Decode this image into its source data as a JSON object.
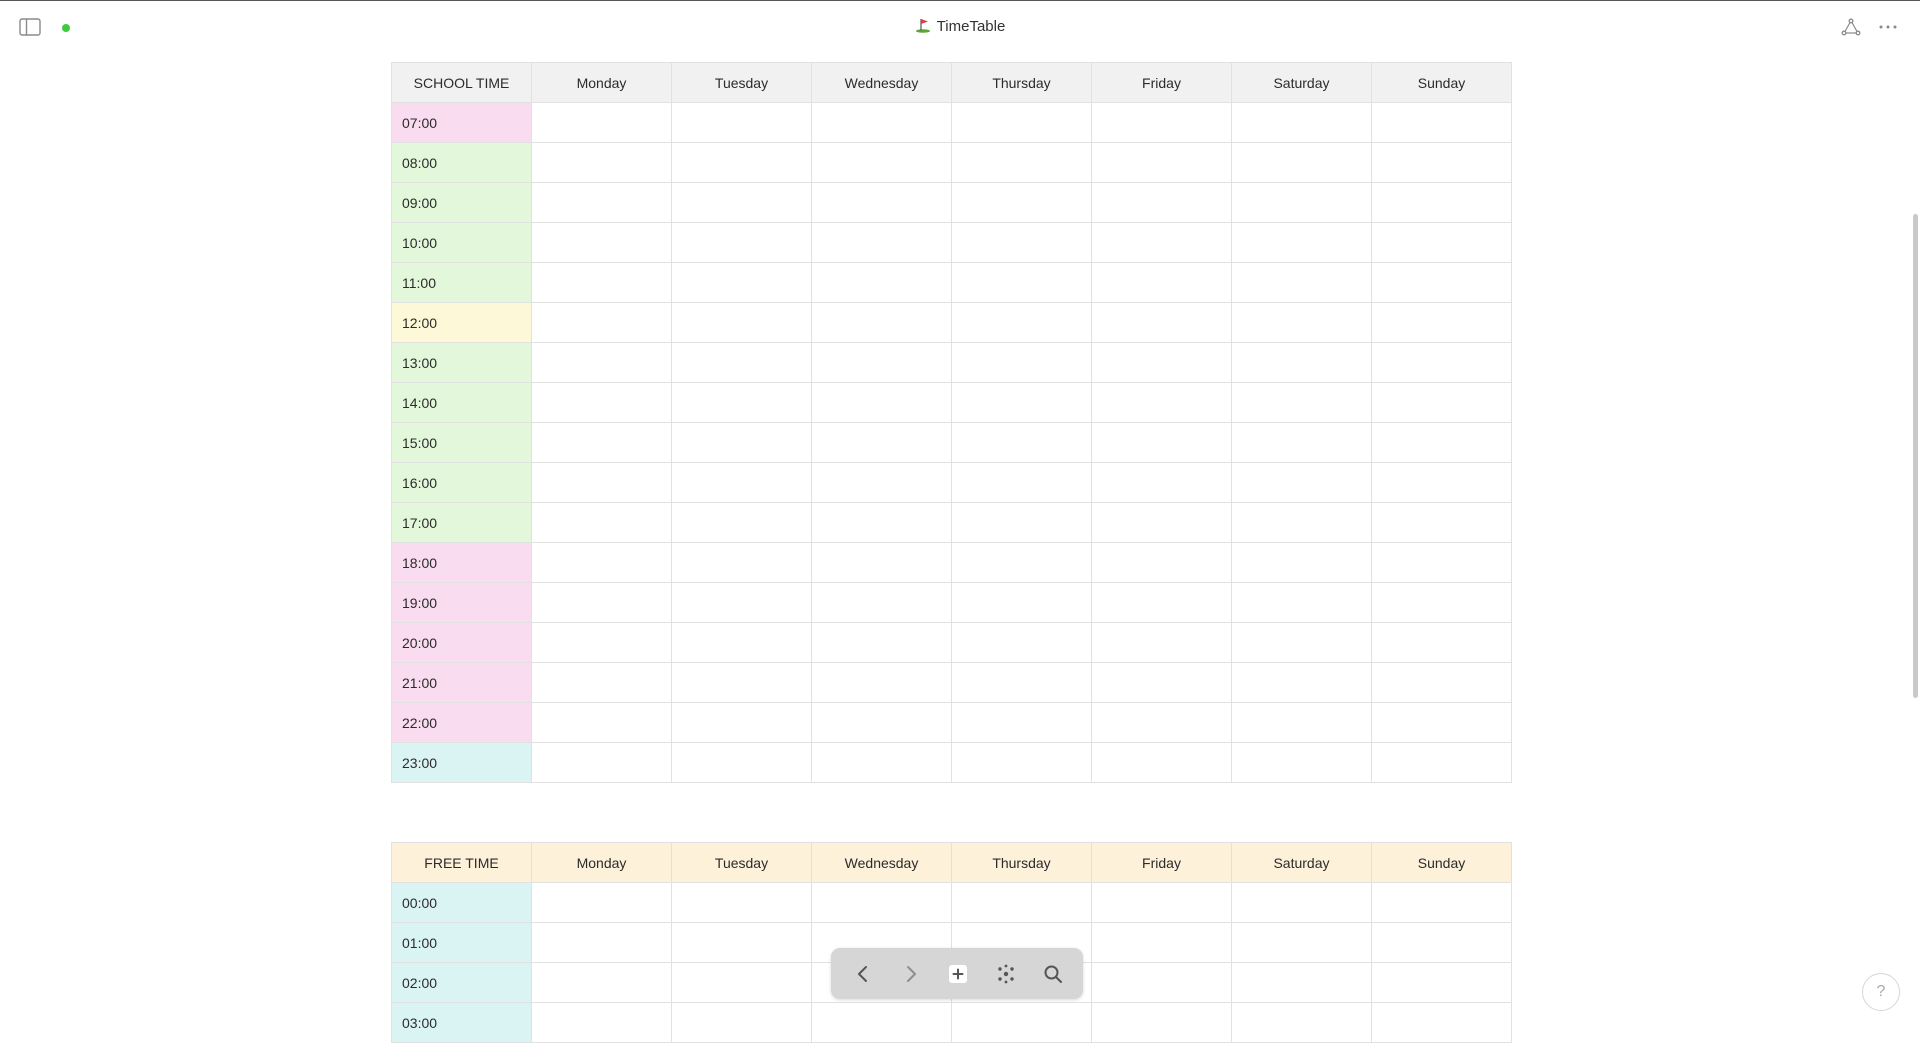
{
  "window": {
    "title": "TimeTable"
  },
  "colors": {
    "pink": "#f9dcef",
    "green": "#e3f7da",
    "yellow": "#fdf8d8",
    "cyan": "#daf4f4",
    "header_gray": "#f1f1f1",
    "header_orange": "#fdf1d9",
    "status_green": "#3ec93e"
  },
  "icons": {
    "sidebar_toggle": "sidebar-toggle-icon",
    "title_emoji": "golf-flag-icon",
    "graph": "graph-icon",
    "more": "more-options-icon"
  },
  "school_table": {
    "corner": "SCHOOL TIME",
    "days": [
      "Monday",
      "Tuesday",
      "Wednesday",
      "Thursday",
      "Friday",
      "Saturday",
      "Sunday"
    ],
    "rows": [
      {
        "time": "07:00",
        "color": "pink"
      },
      {
        "time": "08:00",
        "color": "green"
      },
      {
        "time": "09:00",
        "color": "green"
      },
      {
        "time": "10:00",
        "color": "green"
      },
      {
        "time": "11:00",
        "color": "green"
      },
      {
        "time": "12:00",
        "color": "yellow"
      },
      {
        "time": "13:00",
        "color": "green"
      },
      {
        "time": "14:00",
        "color": "green"
      },
      {
        "time": "15:00",
        "color": "green"
      },
      {
        "time": "16:00",
        "color": "green"
      },
      {
        "time": "17:00",
        "color": "green"
      },
      {
        "time": "18:00",
        "color": "pink"
      },
      {
        "time": "19:00",
        "color": "pink"
      },
      {
        "time": "20:00",
        "color": "pink"
      },
      {
        "time": "21:00",
        "color": "pink"
      },
      {
        "time": "22:00",
        "color": "pink"
      },
      {
        "time": "23:00",
        "color": "cyan"
      }
    ]
  },
  "free_table": {
    "corner": "FREE TIME",
    "days": [
      "Monday",
      "Tuesday",
      "Wednesday",
      "Thursday",
      "Friday",
      "Saturday",
      "Sunday"
    ],
    "rows": [
      {
        "time": "00:00",
        "color": "cyan"
      },
      {
        "time": "01:00",
        "color": "cyan"
      },
      {
        "time": "02:00",
        "color": "cyan"
      },
      {
        "time": "03:00",
        "color": "cyan"
      }
    ]
  },
  "dock": {
    "icons": [
      "back-icon",
      "forward-icon",
      "new-note-icon",
      "graph-view-icon",
      "search-icon"
    ]
  },
  "help": {
    "label": "?"
  }
}
